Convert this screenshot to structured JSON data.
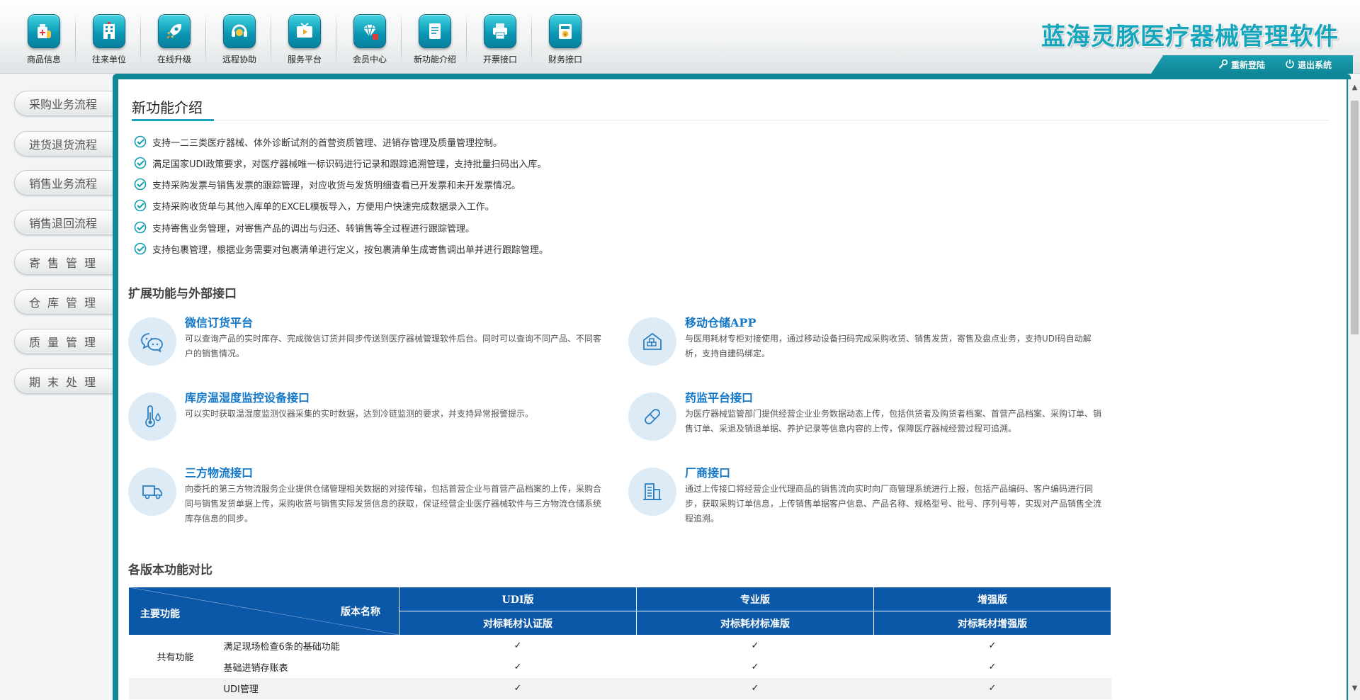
{
  "toolbar": {
    "items": [
      {
        "label": "商品信息",
        "icon": "medicine-box-icon"
      },
      {
        "label": "往来单位",
        "icon": "building-icon"
      },
      {
        "label": "在线升级",
        "icon": "rocket-icon"
      },
      {
        "label": "远程协助",
        "icon": "headset-icon"
      },
      {
        "label": "服务平台",
        "icon": "tv-icon"
      },
      {
        "label": "会员中心",
        "icon": "diamond-icon"
      },
      {
        "label": "新功能介绍",
        "icon": "document-icon"
      },
      {
        "label": "开票接口",
        "icon": "printer-icon"
      },
      {
        "label": "财务接口",
        "icon": "finance-icon"
      }
    ],
    "title": "蓝海灵豚医疗器械管理软件",
    "relogin": "重新登陆",
    "logout": "退出系统"
  },
  "sidebar": {
    "items": [
      "采购业务流程",
      "进货退货流程",
      "销售业务流程",
      "销售退回流程",
      "寄售管理",
      "仓库管理",
      "质量管理",
      "期末处理"
    ]
  },
  "main": {
    "page_title": "新功能介绍",
    "features": [
      "支持一二三类医疗器械、体外诊断试剂的首营资质管理、进销存管理及质量管理控制。",
      "满足国家UDI政策要求，对医疗器械唯一标识码进行记录和跟踪追溯管理，支持批量扫码出入库。",
      "支持采购发票与销售发票的跟踪管理，对应收货与发货明细查看已开发票和未开发票情况。",
      "支持采购收货单与其他入库单的EXCEL模板导入，方便用户快速完成数据录入工作。",
      "支持寄售业务管理，对寄售产品的调出与归还、转销售等全过程进行跟踪管理。",
      "支持包裹管理，根据业务需要对包裹清单进行定义，按包裹清单生成寄售调出单并进行跟踪管理。"
    ],
    "ext_section_title": "扩展功能与外部接口",
    "ext_items": [
      {
        "title": "微信订货平台",
        "desc": "可以查询产品的实时库存、完成微信订货并同步传送到医疗器械管理软件后台。同时可以查询不同产品、不同客户的销售情况。",
        "icon": "wechat-icon"
      },
      {
        "title": "移动仓储APP",
        "desc": "与医用耗材专柜对接使用，通过移动设备扫码完成采购收货、销售发货，寄售及盘点业务，支持UDI码自动解析，支持自建码绑定。",
        "icon": "warehouse-icon"
      },
      {
        "title": "库房温湿度监控设备接口",
        "desc": "可以实时获取温湿度监测仪器采集的实时数据，达到冷链监测的要求，并支持异常报警提示。",
        "icon": "thermometer-icon"
      },
      {
        "title": "药监平台接口",
        "desc": "为医疗器械监管部门提供经营企业业务数据动态上传，包括供货者及购货者档案、首营产品档案、采购订单、销售订单、采退及销退单据、养护记录等信息内容的上传，保障医疗器械经营过程可追溯。",
        "icon": "pill-icon"
      },
      {
        "title": "三方物流接口",
        "desc": "向委托的第三方物流服务企业提供仓储管理相关数据的对接传输，包括首营企业与首营产品档案的上传，采购合同与销售发货单据上传，采购收货与销售实际发货信息的获取，保证经营企业医疗器械软件与三方物流仓储系统库存信息的同步。",
        "icon": "truck-icon"
      },
      {
        "title": "厂商接口",
        "desc": "通过上传接口将经营企业代理商品的销售流向实时向厂商管理系统进行上报，包括产品编码、客户编码进行同步，获取采购订单信息，上传销售单据客户信息、产品名称、规格型号、批号、序列号等，实现对产品销售全流程追溯。",
        "icon": "factory-icon"
      }
    ],
    "compare_section_title": "各版本功能对比",
    "table": {
      "corner_left": "主要功能",
      "corner_right": "版本名称",
      "versions": [
        "UDI版",
        "专业版",
        "增强版"
      ],
      "subtitles": [
        "对标耗材认证版",
        "对标耗材标准版",
        "对标耗材增强版"
      ],
      "group_label": "共有功能",
      "rows": [
        {
          "feature": "满足现场检查6条的基础功能",
          "marks": [
            "✓",
            "✓",
            "✓"
          ]
        },
        {
          "feature": "基础进销存账表",
          "marks": [
            "✓",
            "✓",
            "✓"
          ]
        },
        {
          "feature": "UDI管理",
          "marks": [
            "✓",
            "✓",
            "✓"
          ]
        }
      ]
    }
  },
  "scrollbar": {
    "up": "▲",
    "down": "▼"
  },
  "colors": {
    "accent": "#0f8797",
    "brand_title": "#17a7bd",
    "link_blue": "#1478c8",
    "table_header": "#0c58a8",
    "check_orange": "#f07f13"
  }
}
